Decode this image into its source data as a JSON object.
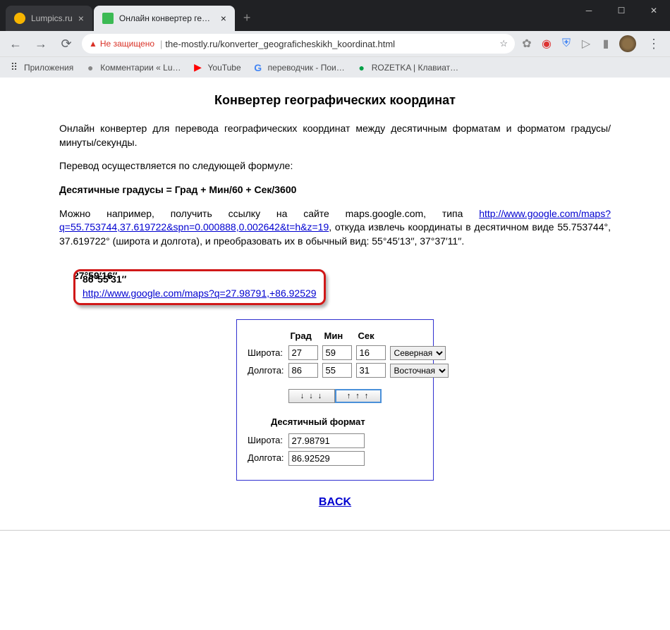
{
  "window": {
    "tabs": [
      {
        "title": "Lumpics.ru",
        "favicon_color": "#f7b500"
      },
      {
        "title": "Онлайн конвертер географичес",
        "favicon_color": "#3cba54"
      }
    ]
  },
  "toolbar": {
    "security_text": "Не защищено",
    "url": "the-mostly.ru/konverter_geograficheskikh_koordinat.html"
  },
  "bookmarks": {
    "apps": "Приложения",
    "items": [
      {
        "label": "Комментарии « Lu…",
        "color": "#888"
      },
      {
        "label": "YouTube",
        "color": "#ff0000"
      },
      {
        "label": "переводчик - Пои…",
        "color": "#4285f4"
      },
      {
        "label": "ROZETKA | Клавиат…",
        "color": "#00a046"
      }
    ]
  },
  "page": {
    "heading": "Конвертер географических координат",
    "intro": "Онлайн конвертер для перевода географических координат между десятичным форматам и форматом градусы/минуты/секунды.",
    "formula_intro": "Перевод осуществляется по следующей формуле:",
    "formula": "Десятичные градусы = Град + Мин/60 + Сек/3600",
    "example_pre": "Можно например, получить ссылку на сайте maps.google.com, типа ",
    "example_link": "http://www.google.com/maps?q=55.753744,37.619722&spn=0.000888,0.002642&t=h&z=19",
    "example_post": ", откуда извлечь координаты в десятичном виде 55.753744°, 37.619722° (широта и долгота), и преобразовать их в обычный вид: 55°45′13′′, 37°37′11′′.",
    "result": {
      "lat_dms": "27°59′16′′",
      "lon_dms": "86°55′31′′",
      "maps_link": "http://www.google.com/maps?q=27.98791,+86.92529"
    },
    "converter": {
      "head_grad": "Град",
      "head_min": "Мин",
      "head_sec": "Сек",
      "lat_label": "Широта:",
      "lon_label": "Долгота:",
      "lat": {
        "deg": "27",
        "min": "59",
        "sec": "16",
        "dir": "Северная"
      },
      "lon": {
        "deg": "86",
        "min": "55",
        "sec": "31",
        "dir": "Восточная"
      },
      "down_arrows": "↓ ↓ ↓",
      "up_arrows": "↑ ↑ ↑",
      "decimal_header": "Десятичный формат",
      "dec_lat_label": "Широта:",
      "dec_lon_label": "Долгота:",
      "dec_lat": "27.98791",
      "dec_lon": "86.92529"
    },
    "back": "BACK"
  }
}
